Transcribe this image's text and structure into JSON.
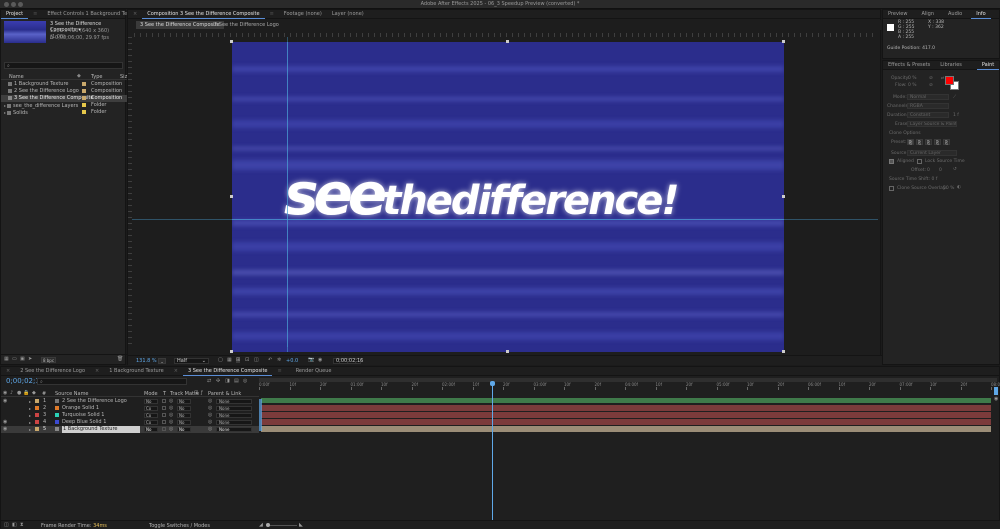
{
  "window": {
    "title": "Adobe After Effects 2025 - 06_3 Speedup Preview (converted) *"
  },
  "project": {
    "tab_project": "Project",
    "tab_effect_controls": "Effect Controls 1 Background Texture",
    "selected_name": "3 See the Difference Composite ▾",
    "selected_line1": "1280 x 720  (640 x 360) (1.00)",
    "selected_line2": "Δ 0;00;06;00, 29.97 fps",
    "search_placeholder": "",
    "col_name": "Name",
    "col_type": "Type",
    "col_size": "Siz",
    "items": [
      {
        "name": "1 Background Texture",
        "type": "Composition",
        "color": "#c9a86b",
        "selected": false
      },
      {
        "name": "2 See the Difference Logo",
        "type": "Composition",
        "color": "#c9a86b",
        "selected": false
      },
      {
        "name": "3 See the Difference Composite",
        "type": "Composition",
        "color": "#c9a86b",
        "selected": true
      },
      {
        "name": "see_the_difference Layers",
        "type": "Folder",
        "color": "#e6c84a",
        "selected": false
      },
      {
        "name": "Solids",
        "type": "Folder",
        "color": "#e6c84a",
        "selected": false
      }
    ],
    "bpc": "8 bpc"
  },
  "composition": {
    "tab_comp": "Composition 3 See the Difference Composite",
    "tab_footage": "Footage (none)",
    "tab_layer": "Layer (none)",
    "subtab_active": "3 See the Difference Composite",
    "subtab_other": "2 See the Difference Logo",
    "canvas_text_see": "see",
    "canvas_text_rest": "thedifference!",
    "canvas_bg": "#2b2d8c",
    "zoom": "131.8",
    "zoom_unit": "%",
    "resolution": "Half",
    "exposure": "+0.0",
    "timecode": "0;00;02;16"
  },
  "info_panel": {
    "tab_preview": "Preview",
    "tab_align": "Align",
    "tab_audio": "Audio",
    "tab_info": "Info",
    "r": "R : 255",
    "g": "G : 255",
    "b": "B : 255",
    "a": "A : 255",
    "x": "X : 338",
    "y": "Y : 362",
    "guide_position": "Guide Position: 417.0"
  },
  "paint_panel": {
    "tab_effects": "Effects & Presets",
    "tab_libraries": "Libraries",
    "tab_paint": "Paint",
    "opacity_label": "Opacity:",
    "opacity_value": "0 %",
    "flow_label": "Flow:",
    "flow_value": "0 %",
    "mode_label": "Mode:",
    "mode_value": "Normal",
    "channels_label": "Channels:",
    "channels_value": "RGBA",
    "duration_label": "Duration:",
    "duration_value": "Constant",
    "duration_num": "1 f",
    "erase_label": "Erase:",
    "erase_value": "Layer Source & Paint",
    "clone_options": "Clone Options",
    "preset_label": "Preset:",
    "source_label": "Source:",
    "source_value": "Current Layer",
    "aligned": "Aligned",
    "lock_source_time": "Lock Source Time",
    "offset_label": "Offset:",
    "offset_x": "0",
    "offset_y": "0",
    "source_time_shift": "Source Time Shift: 0 f",
    "clone_overlay": "Clone Source Overlay:",
    "clone_overlay_value": "50 %",
    "fg_color": "#ff0000",
    "bg_color": "#ffffff"
  },
  "timeline": {
    "tabs": [
      "2 See the Difference Logo",
      "1 Background Texture",
      "3 See the Difference Composite",
      "Render Queue"
    ],
    "current_time": "0;00;02;16",
    "col_num": "#",
    "col_source": "Source Name",
    "col_mode": "Mode",
    "col_t": "T",
    "col_trkmat": "Track Matte",
    "col_parent": "Parent & Link",
    "layers": [
      {
        "num": "1",
        "name": "2 See the Difference Logo",
        "color": "#c9a86b",
        "mode": "No",
        "trk": "No",
        "parent": "None",
        "bar": "#3f7a4a"
      },
      {
        "num": "2",
        "name": "Orange Solid 1",
        "color": "#e07b2a",
        "mode": "Co",
        "trk": "No",
        "parent": "None",
        "bar": "#7b3b3b"
      },
      {
        "num": "3",
        "name": "Turquoise Solid 1",
        "color": "#2ad1b7",
        "mode": "Co",
        "trk": "No",
        "parent": "None",
        "bar": "#7b3b3b"
      },
      {
        "num": "4",
        "name": "Deep Blue Solid 1",
        "color": "#3b4ad1",
        "mode": "Co",
        "trk": "No",
        "parent": "None",
        "bar": "#7b3b3b"
      },
      {
        "num": "5",
        "name": "1 Background Texture",
        "color": "#c9a86b",
        "mode": "No",
        "trk": "No",
        "parent": "None",
        "bar": "#9b8d77"
      }
    ],
    "ruler_labels": [
      "0:00f",
      "10f",
      "20f",
      "01:00f",
      "10f",
      "20f",
      "02:00f",
      "10f",
      "20f",
      "03:00f",
      "10f",
      "20f",
      "04:00f",
      "10f",
      "20f",
      "05:00f",
      "10f",
      "20f",
      "06:00f",
      "10f",
      "20f",
      "07:00f",
      "10f",
      "20f",
      "08:0"
    ],
    "frame_render_label": "Frame Render Time:",
    "frame_render_value": "34ms",
    "toggle_label": "Toggle Switches / Modes"
  }
}
